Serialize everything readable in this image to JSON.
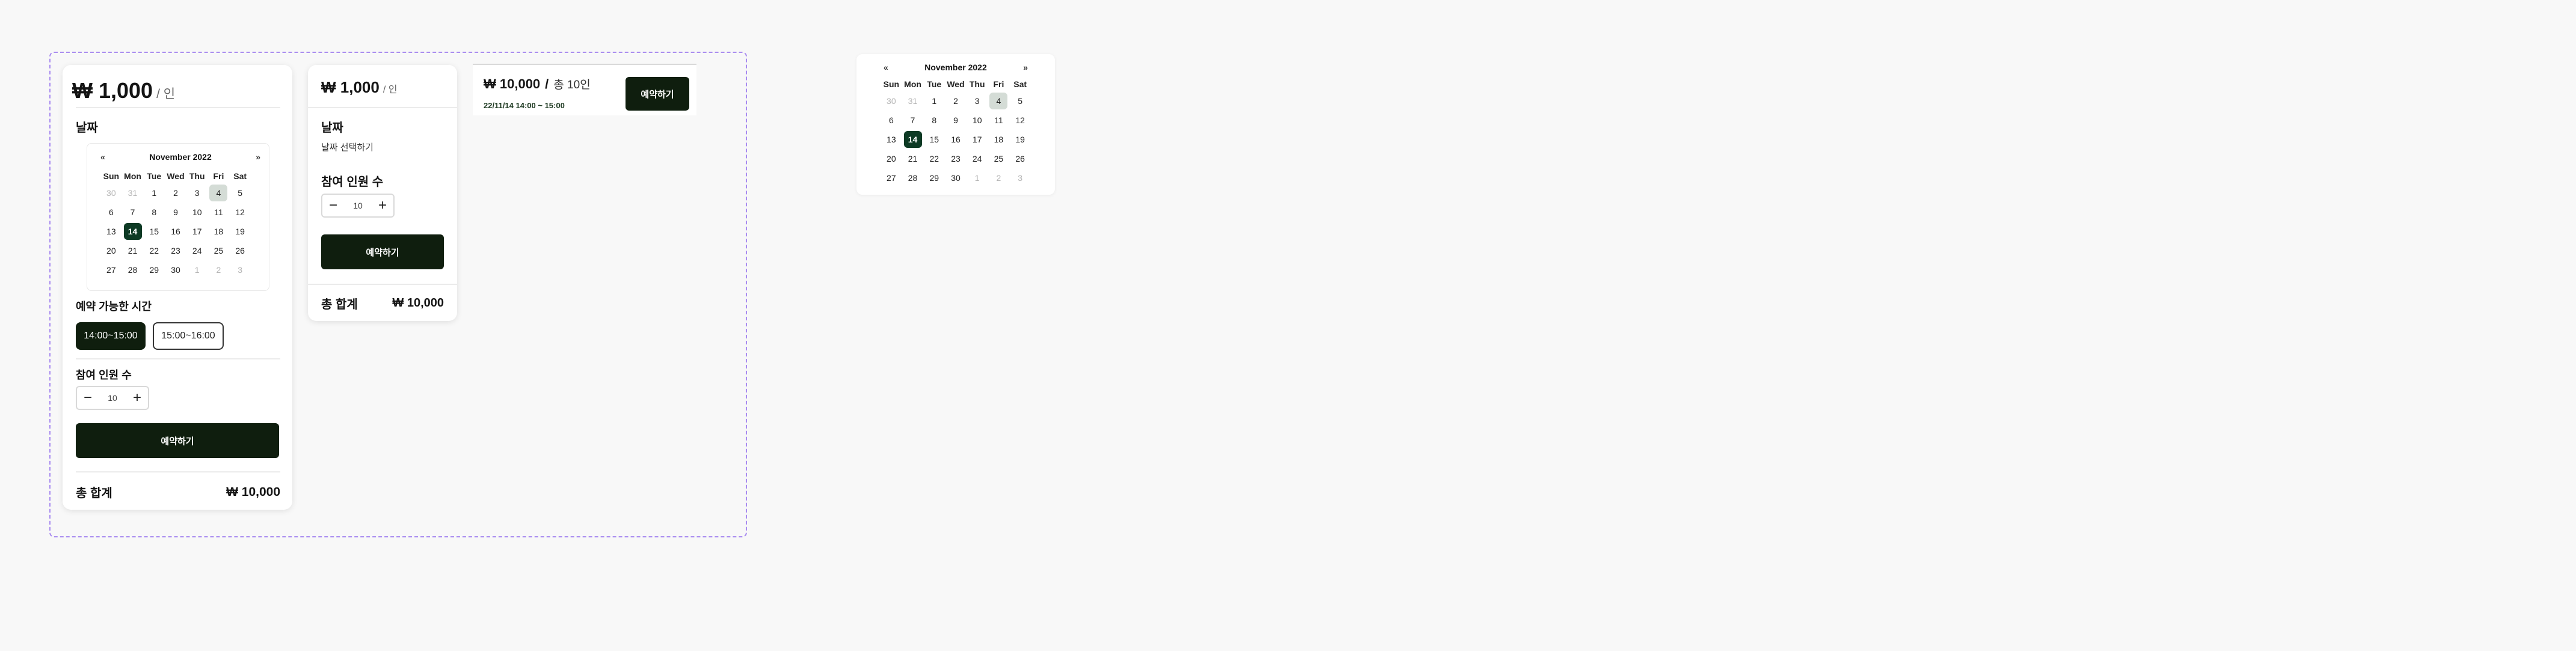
{
  "card1": {
    "price": "₩ 1,000",
    "unit": "/ 인",
    "date_title": "날짜",
    "times_title": "예약 가능한 시간",
    "times": [
      "14:00~15:00",
      "15:00~16:00"
    ],
    "people_title": "참여 인원 수",
    "people_value": "10",
    "minus": "−",
    "plus": "+",
    "book_label": "예약하기",
    "total_label": "총 합계",
    "total_value": "₩ 10,000"
  },
  "card2": {
    "price": "₩ 1,000",
    "unit": "/ 인",
    "date_title": "날짜",
    "date_prompt": "날짜 선택하기",
    "people_title": "참여 인원 수",
    "people_value": "10",
    "minus": "−",
    "plus": "+",
    "book_label": "예약하기",
    "total_label": "총 합계",
    "total_value": "₩ 10,000"
  },
  "bar": {
    "price": "₩ 10,000",
    "slash": "/",
    "people": "총 10인",
    "schedule": "22/11/14 14:00 ~ 15:00",
    "book_label": "예약하기"
  },
  "calendar": {
    "month": "November 2022",
    "prev": "«",
    "next": "»",
    "dow": [
      "Sun",
      "Mon",
      "Tue",
      "Wed",
      "Thu",
      "Fri",
      "Sat"
    ],
    "weeks": [
      [
        "30",
        "31",
        "1",
        "2",
        "3",
        "4",
        "5"
      ],
      [
        "6",
        "7",
        "8",
        "9",
        "10",
        "11",
        "12"
      ],
      [
        "13",
        "14",
        "15",
        "16",
        "17",
        "18",
        "19"
      ],
      [
        "20",
        "21",
        "22",
        "23",
        "24",
        "25",
        "26"
      ],
      [
        "27",
        "28",
        "29",
        "30",
        "1",
        "2",
        "3"
      ]
    ],
    "muted": [
      [
        0,
        0
      ],
      [
        0,
        1
      ],
      [
        4,
        4
      ],
      [
        4,
        5
      ],
      [
        4,
        6
      ]
    ],
    "today": [
      0,
      5
    ],
    "selected": [
      2,
      1
    ]
  },
  "colors": {
    "accent_dark": "#0f1e0e",
    "selected_day": "#0d3a24",
    "today_day": "#d4dcd6",
    "frame_dash": "#a98cf0"
  }
}
